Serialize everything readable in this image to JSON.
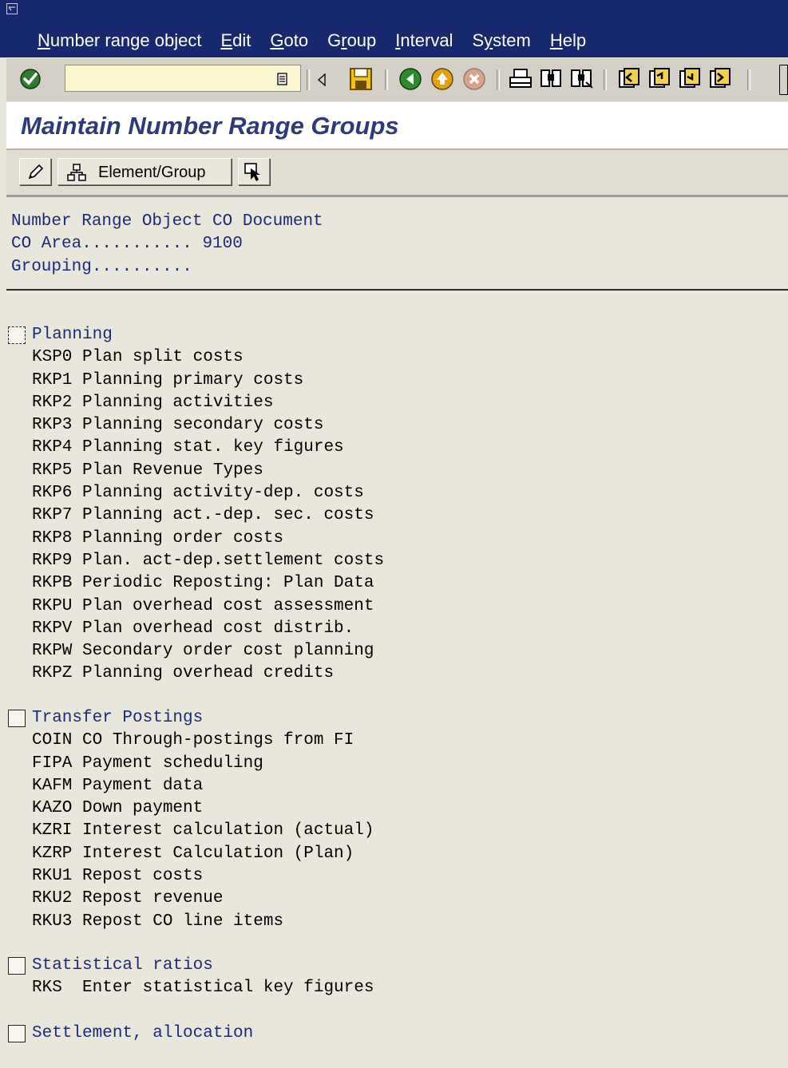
{
  "menu": {
    "items": [
      {
        "label": "Number range object",
        "accel": "N"
      },
      {
        "label": "Edit",
        "accel": "E"
      },
      {
        "label": "Goto",
        "accel": "G"
      },
      {
        "label": "Group",
        "accel": "r"
      },
      {
        "label": "Interval",
        "accel": "I"
      },
      {
        "label": "System",
        "accel": "y"
      },
      {
        "label": "Help",
        "accel": "H"
      }
    ]
  },
  "toolbar": {
    "command_value": "",
    "icons": [
      "enter-icon",
      "history-icon",
      "back-arrow-icon",
      "save-icon",
      "back-icon",
      "exit-icon",
      "cancel-icon",
      "print-icon",
      "find-icon",
      "find-next-icon",
      "first-page-icon",
      "previous-page-icon",
      "next-page-icon",
      "last-page-icon"
    ]
  },
  "page": {
    "title": "Maintain Number Range Groups"
  },
  "app_toolbar": {
    "edit_icon": "pencil-icon",
    "element_group_label": "Element/Group",
    "element_group_icon": "hierarchy-icon",
    "select_icon": "cursor-select-icon"
  },
  "header": {
    "line1": "Number Range Object CO Document",
    "line2": "CO Area........... 9100",
    "line3": "Grouping.........."
  },
  "groups": [
    {
      "title": "Planning",
      "items": [
        "KSP0 Plan split costs",
        "RKP1 Planning primary costs",
        "RKP2 Planning activities",
        "RKP3 Planning secondary costs",
        "RKP4 Planning stat. key figures",
        "RKP5 Plan Revenue Types",
        "RKP6 Planning activity-dep. costs",
        "RKP7 Planning act.-dep. sec. costs",
        "RKP8 Planning order costs",
        "RKP9 Plan. act-dep.settlement costs",
        "RKPB Periodic Reposting: Plan Data",
        "RKPU Plan overhead cost assessment",
        "RKPV Plan overhead cost distrib.",
        "RKPW Secondary order cost planning",
        "RKPZ Planning overhead credits"
      ]
    },
    {
      "title": "Transfer Postings",
      "items": [
        "COIN CO Through-postings from FI",
        "FIPA Payment scheduling",
        "KAFM Payment data",
        "KAZO Down payment",
        "KZRI Interest calculation (actual)",
        "KZRP Interest Calculation (Plan)",
        "RKU1 Repost costs",
        "RKU2 Repost revenue",
        "RKU3 Repost CO line items"
      ]
    },
    {
      "title": "Statistical ratios",
      "items": [
        "RKS  Enter statistical key figures"
      ]
    },
    {
      "title": "Settlement, allocation",
      "items": []
    }
  ]
}
